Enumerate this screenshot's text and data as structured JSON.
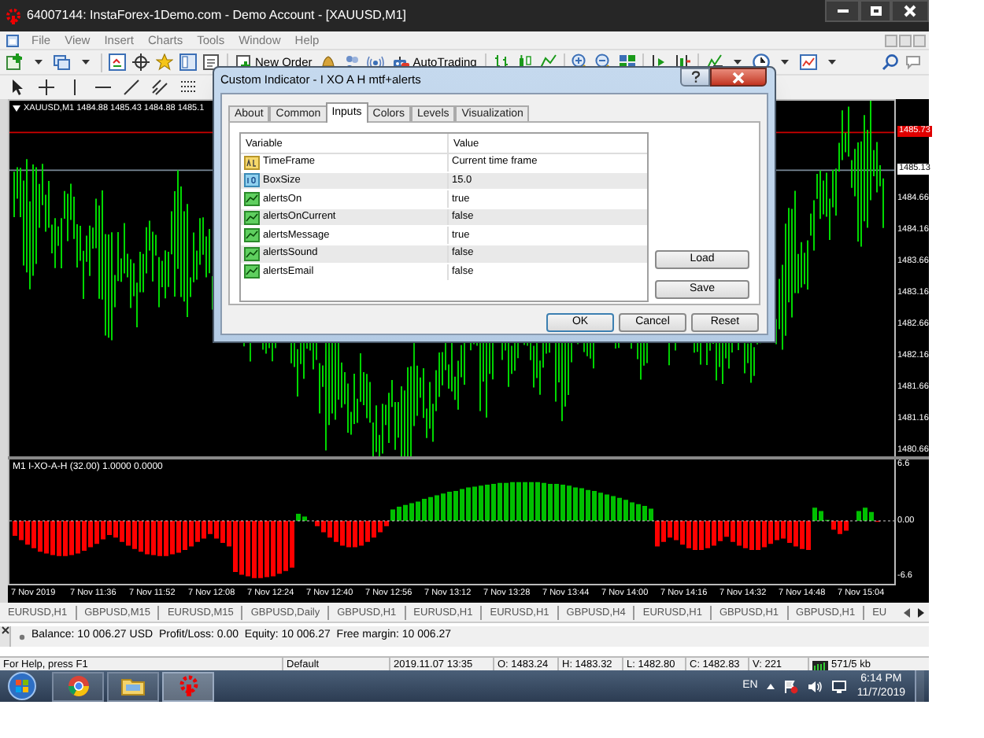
{
  "window": {
    "title": "64007144: InstaForex-1Demo.com - Demo Account - [XAUUSD,M1]"
  },
  "menu": [
    "File",
    "View",
    "Insert",
    "Charts",
    "Tools",
    "Window",
    "Help"
  ],
  "toolbar": {
    "new_order": "New Order",
    "autotrading": "AutoTrading"
  },
  "chart": {
    "header": "XAUUSD,M1 1484.88 1485.43 1484.88 1485.1",
    "ask_label": "1485.73",
    "bid_label": "1485.13",
    "price_ticks": [
      "1484.66",
      "1484.16",
      "1483.66",
      "1483.16",
      "1482.66",
      "1482.16",
      "1481.66",
      "1481.16",
      "1480.66"
    ],
    "indicator_header": "M1 I-XO-A-H (32.00) 1.0000 0.0000",
    "indicator_ticks": [
      "6.6",
      "0.00",
      "-6.6"
    ],
    "time_ticks": [
      "7 Nov 2019",
      "7 Nov 11:36",
      "7 Nov 11:52",
      "7 Nov 12:08",
      "7 Nov 12:24",
      "7 Nov 12:40",
      "7 Nov 12:56",
      "7 Nov 13:12",
      "7 Nov 13:28",
      "7 Nov 13:44",
      "7 Nov 14:00",
      "7 Nov 14:16",
      "7 Nov 14:32",
      "7 Nov 14:48",
      "7 Nov 15:04"
    ]
  },
  "chart_tabs": [
    "EURUSD,H1",
    "GBPUSD,M15",
    "EURUSD,M15",
    "GBPUSD,Daily",
    "GBPUSD,H1",
    "EURUSD,H1",
    "EURUSD,H1",
    "GBPUSD,H4",
    "EURUSD,H1",
    "GBPUSD,H1",
    "GBPUSD,H1",
    "EU"
  ],
  "terminal": {
    "account_line": "Balance: 10 006.27 USD  Profit/Loss: 0.00  Equity: 10 006.27  Free margin: 10 006.27"
  },
  "status_bar": [
    "For Help, press F1",
    "Default",
    "2019.11.07 13:35",
    "O: 1483.24",
    "H: 1483.32",
    "L: 1482.80",
    "C: 1482.83",
    "V: 221",
    "571/5 kb"
  ],
  "taskbar": {
    "language": "EN",
    "time": "6:14 PM",
    "date": "11/7/2019"
  },
  "dialog": {
    "title": "Custom Indicator - I XO A H mtf+alerts",
    "tabs": [
      {
        "label": "About",
        "selected": false
      },
      {
        "label": "Common",
        "selected": false
      },
      {
        "label": "Inputs",
        "selected": true
      },
      {
        "label": "Colors",
        "selected": false
      },
      {
        "label": "Levels",
        "selected": false
      },
      {
        "label": "Visualization",
        "selected": false
      }
    ],
    "columns": [
      "Variable",
      "Value"
    ],
    "rows": [
      {
        "kind": "string",
        "variable": "TimeFrame",
        "value": "Current time frame"
      },
      {
        "kind": "number",
        "variable": "BoxSize",
        "value": "15.0"
      },
      {
        "kind": "bool",
        "variable": "alertsOn",
        "value": "true"
      },
      {
        "kind": "bool",
        "variable": "alertsOnCurrent",
        "value": "false"
      },
      {
        "kind": "bool",
        "variable": "alertsMessage",
        "value": "true"
      },
      {
        "kind": "bool",
        "variable": "alertsSound",
        "value": "false"
      },
      {
        "kind": "bool",
        "variable": "alertsEmail",
        "value": "false"
      }
    ],
    "side_buttons": [
      "Load",
      "Save"
    ],
    "buttons": [
      "OK",
      "Cancel",
      "Reset"
    ]
  }
}
